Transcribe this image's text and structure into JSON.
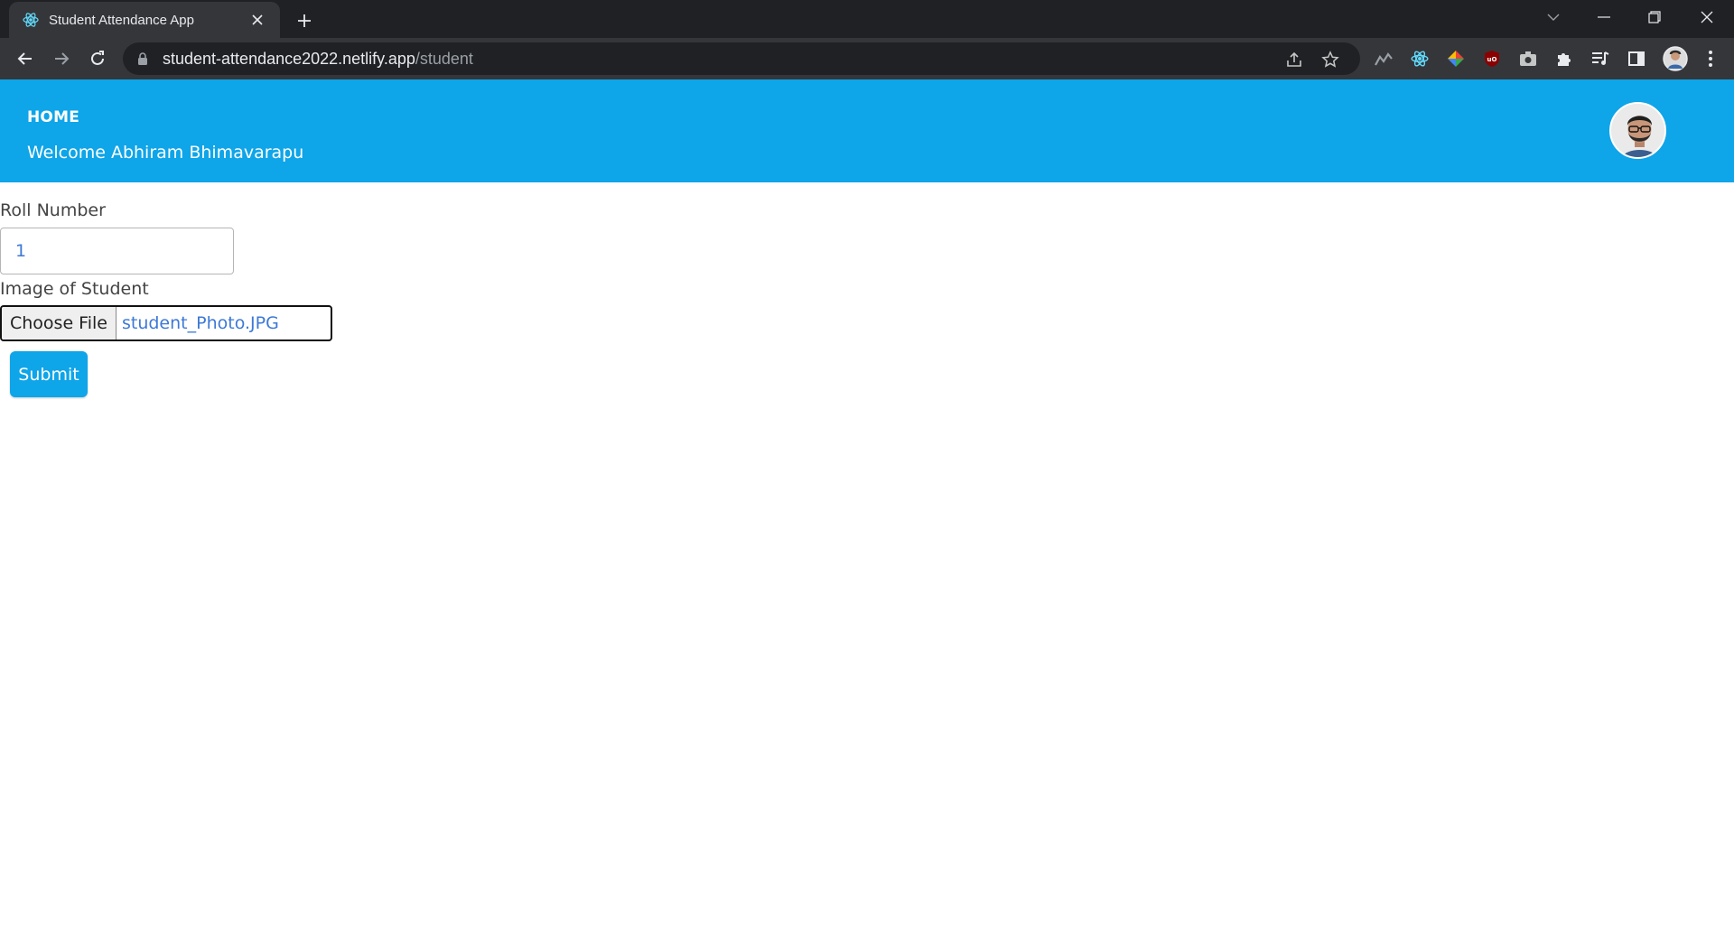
{
  "browser": {
    "tab_title": "Student Attendance App",
    "url_host": "student-attendance2022.netlify.app",
    "url_path": "/student"
  },
  "header": {
    "home_label": "HOME",
    "welcome_text": "Welcome Abhiram Bhimavarapu"
  },
  "form": {
    "roll_label": "Roll Number",
    "roll_value": "1",
    "image_label": "Image of Student",
    "choose_file_label": "Choose File",
    "file_name": "student_Photo.JPG",
    "submit_label": "Submit"
  },
  "icons": {
    "tab_favicon": "react-atom-icon",
    "back": "arrow-left-icon",
    "forward": "arrow-right-icon",
    "reload": "reload-icon",
    "lock": "lock-icon",
    "share": "share-icon",
    "bookmark": "star-icon"
  },
  "colors": {
    "header_bg": "#0ea5e9",
    "button_bg": "#0ea5e9",
    "input_text": "#3d79d6",
    "chrome_dark": "#202124",
    "chrome_toolbar": "#35363a"
  }
}
